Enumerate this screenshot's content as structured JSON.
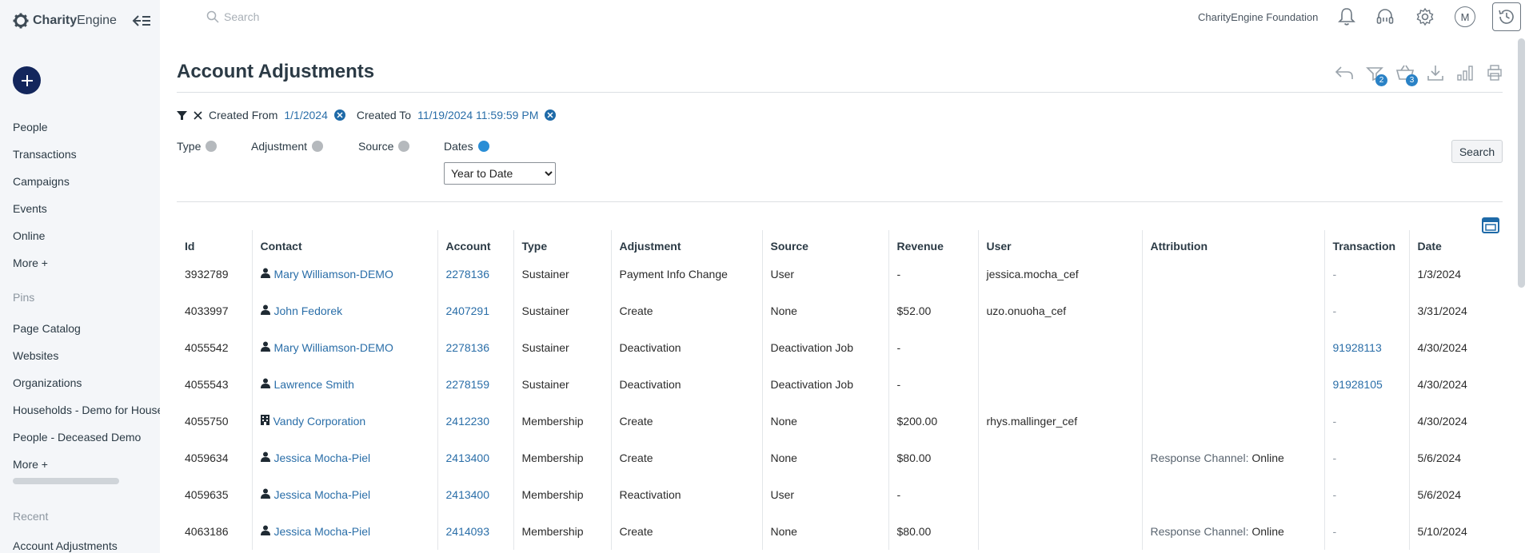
{
  "app": {
    "logo_text_bold": "Charity",
    "logo_text_rest": "Engine",
    "org_name": "CharityEngine Foundation",
    "avatar_initial": "M",
    "search_placeholder": "Search"
  },
  "sidebar": {
    "nav": [
      "People",
      "Transactions",
      "Campaigns",
      "Events",
      "Online",
      "More +"
    ],
    "pins_label": "Pins",
    "pins": [
      "Page Catalog",
      "Websites",
      "Organizations",
      "Households - Demo for Households",
      "People - Deceased Demo",
      "More +"
    ],
    "recent_label": "Recent",
    "recent": [
      "Account Adjustments"
    ]
  },
  "page": {
    "title": "Account Adjustments",
    "badges": {
      "filter_count": "2",
      "basket_count": "3"
    }
  },
  "filters": {
    "created_from_label": "Created From",
    "created_from_value": "1/1/2024",
    "created_to_label": "Created To",
    "created_to_value": "11/19/2024 11:59:59 PM",
    "facets": {
      "type": "Type",
      "adjustment": "Adjustment",
      "source": "Source",
      "dates": "Dates"
    },
    "dates_selected": "Year to Date",
    "search_button": "Search"
  },
  "table": {
    "columns": [
      "Id",
      "Contact",
      "Account",
      "Type",
      "Adjustment",
      "Source",
      "Revenue",
      "User",
      "Attribution",
      "Transaction",
      "Date"
    ],
    "rows": [
      {
        "id": "3932789",
        "contact": "Mary Williamson-DEMO",
        "contact_kind": "person",
        "account": "2278136",
        "type": "Sustainer",
        "adjustment": "Payment Info Change",
        "source": "User",
        "revenue": "-",
        "user": "jessica.mocha_cef",
        "attribution_label": "",
        "attribution_value": "",
        "transaction": "-",
        "date": "1/3/2024"
      },
      {
        "id": "4033997",
        "contact": "John Fedorek",
        "contact_kind": "person",
        "account": "2407291",
        "type": "Sustainer",
        "adjustment": "Create",
        "source": "None",
        "revenue": "$52.00",
        "user": "uzo.onuoha_cef",
        "attribution_label": "",
        "attribution_value": "",
        "transaction": "-",
        "date": "3/31/2024"
      },
      {
        "id": "4055542",
        "contact": "Mary Williamson-DEMO",
        "contact_kind": "person",
        "account": "2278136",
        "type": "Sustainer",
        "adjustment": "Deactivation",
        "source": "Deactivation Job",
        "revenue": "-",
        "user": "",
        "attribution_label": "",
        "attribution_value": "",
        "transaction": "91928113",
        "date": "4/30/2024"
      },
      {
        "id": "4055543",
        "contact": "Lawrence Smith",
        "contact_kind": "person",
        "account": "2278159",
        "type": "Sustainer",
        "adjustment": "Deactivation",
        "source": "Deactivation Job",
        "revenue": "-",
        "user": "",
        "attribution_label": "",
        "attribution_value": "",
        "transaction": "91928105",
        "date": "4/30/2024"
      },
      {
        "id": "4055750",
        "contact": "Vandy Corporation",
        "contact_kind": "organization",
        "account": "2412230",
        "type": "Membership",
        "adjustment": "Create",
        "source": "None",
        "revenue": "$200.00",
        "user": "rhys.mallinger_cef",
        "attribution_label": "",
        "attribution_value": "",
        "transaction": "-",
        "date": "4/30/2024"
      },
      {
        "id": "4059634",
        "contact": "Jessica Mocha-Piel",
        "contact_kind": "person",
        "account": "2413400",
        "type": "Membership",
        "adjustment": "Create",
        "source": "None",
        "revenue": "$80.00",
        "user": "",
        "attribution_label": "Response Channel:",
        "attribution_value": "Online",
        "transaction": "-",
        "date": "5/6/2024"
      },
      {
        "id": "4059635",
        "contact": "Jessica Mocha-Piel",
        "contact_kind": "person",
        "account": "2413400",
        "type": "Membership",
        "adjustment": "Reactivation",
        "source": "User",
        "revenue": "-",
        "user": "",
        "attribution_label": "",
        "attribution_value": "",
        "transaction": "-",
        "date": "5/6/2024"
      },
      {
        "id": "4063186",
        "contact": "Jessica Mocha-Piel",
        "contact_kind": "person",
        "account": "2414093",
        "type": "Membership",
        "adjustment": "Create",
        "source": "None",
        "revenue": "$80.00",
        "user": "",
        "attribution_label": "Response Channel:",
        "attribution_value": "Online",
        "transaction": "-",
        "date": "5/10/2024"
      }
    ]
  },
  "colors": {
    "accent": "#2a6ea8",
    "primary_dark": "#13265c",
    "badge": "#2a82c6",
    "dates_dot": "#2a8ed6",
    "sidebar_bg": "#f4f6f9"
  }
}
